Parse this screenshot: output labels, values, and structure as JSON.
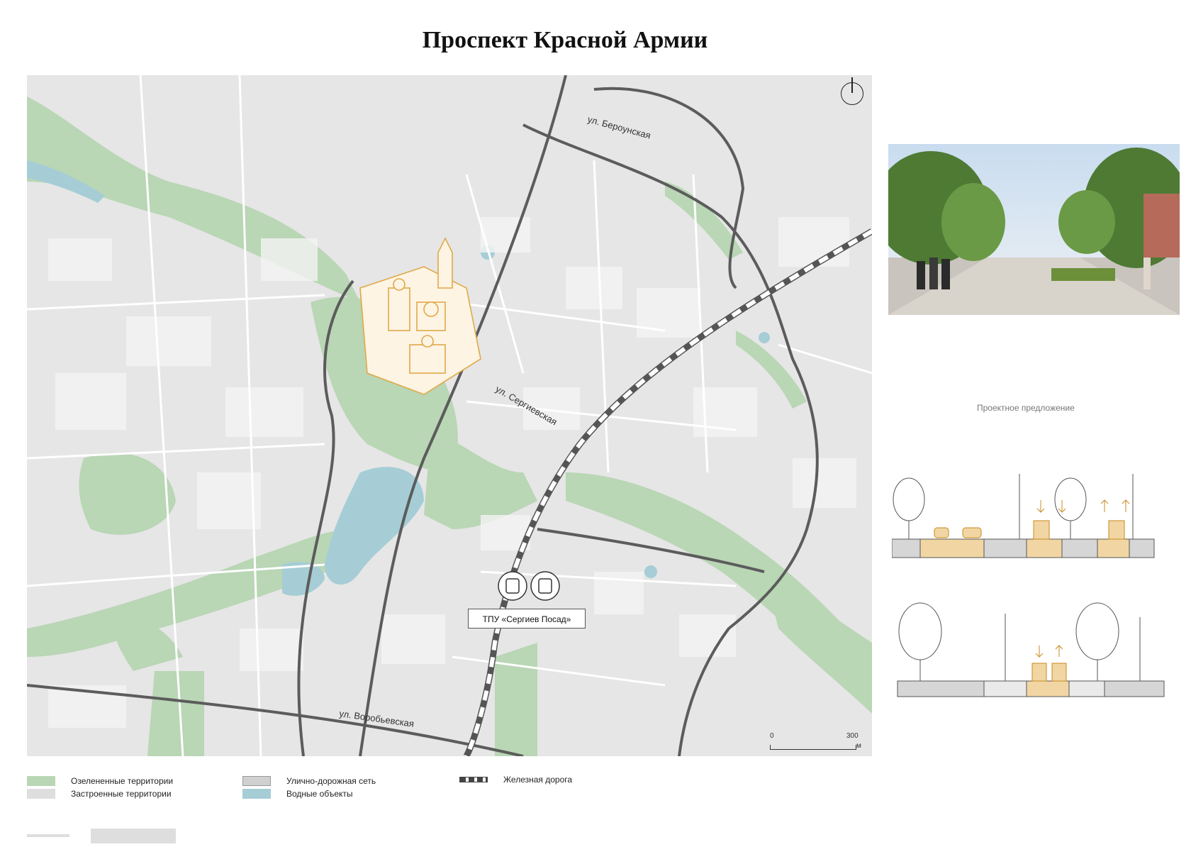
{
  "title": "Проспект Красной Армии",
  "map": {
    "streets": {
      "berounskaya": "ул. Бероунская",
      "sergievskaya": "ул. Сергиевская",
      "vorobyevskaya": "ул. Воробьевская"
    },
    "tpu_label": "ТПУ «Сергиев Посад»",
    "tpu_icons": [
      "train-icon",
      "bus-icon"
    ],
    "scale": {
      "start": "0",
      "end": "300",
      "unit": "м"
    },
    "colors": {
      "green": "#b9d6b5",
      "built": "#dedede",
      "water": "#a6cdd6",
      "roads": "#9a9a9a",
      "kremlin": "#e0a948"
    }
  },
  "photo": {
    "icon": "street-render-photo"
  },
  "caption": "Проектное предложение",
  "legend": {
    "green": "Озелененные территории",
    "built": "Застроенные территории",
    "roads": "Улично-дорожная сеть",
    "water": "Водные объекты",
    "rail": "Железная дорога"
  }
}
